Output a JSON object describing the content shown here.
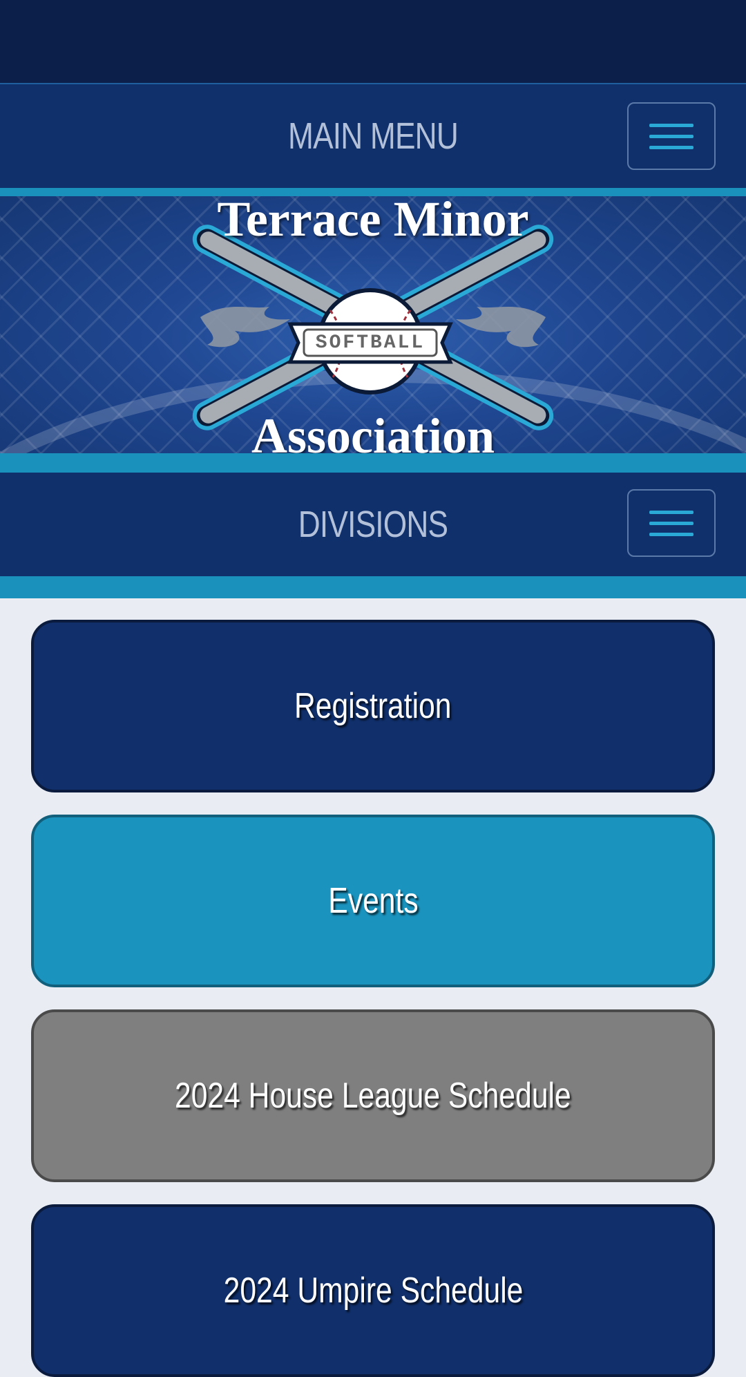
{
  "main_menu": {
    "label": "MAIN MENU"
  },
  "hero": {
    "title_top": "Terrace Minor",
    "title_bottom": "Association",
    "banner_text": "SOFTBALL"
  },
  "divisions_menu": {
    "label": "DIVISIONS"
  },
  "buttons": [
    {
      "label": "Registration",
      "color": "#102f6b"
    },
    {
      "label": "Events",
      "color": "#1a93be"
    },
    {
      "label": "2024 House League Schedule",
      "color": "#7f7f7f"
    },
    {
      "label": "2024 Umpire Schedule",
      "color": "#102f6b"
    }
  ],
  "colors": {
    "navy": "#102f6b",
    "dark_navy": "#0c1f4a",
    "accent": "#1a91bd",
    "gray": "#7f7f7f"
  }
}
